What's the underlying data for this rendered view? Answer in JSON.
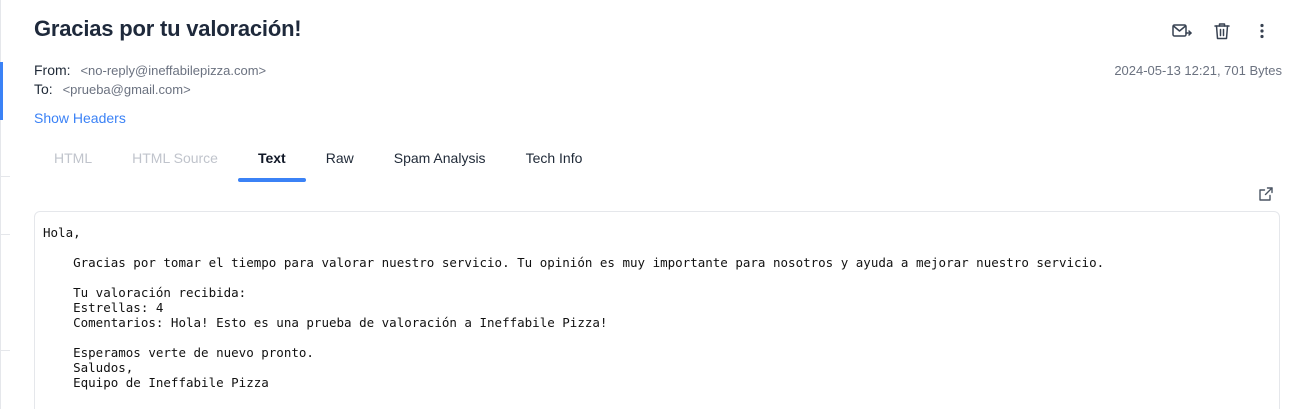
{
  "message": {
    "subject": "Gracias por tu valoración!",
    "from_label": "From:",
    "from_address": "<no-reply@ineffabilepizza.com>",
    "to_label": "To:",
    "to_address": "<prueba@gmail.com>",
    "date_size": "2024-05-13 12:21, 701 Bytes",
    "show_headers": "Show Headers"
  },
  "actions": {
    "forward_icon": "mail-forward-icon",
    "delete_icon": "trash-icon",
    "more_icon": "more-vertical-icon"
  },
  "tabs": [
    {
      "label": "HTML",
      "state": "disabled"
    },
    {
      "label": "HTML Source",
      "state": "disabled"
    },
    {
      "label": "Text",
      "state": "active"
    },
    {
      "label": "Raw",
      "state": "normal"
    },
    {
      "label": "Spam Analysis",
      "state": "normal"
    },
    {
      "label": "Tech Info",
      "state": "normal"
    }
  ],
  "body": {
    "text": "Hola,\n\n    Gracias por tomar el tiempo para valorar nuestro servicio. Tu opinión es muy importante para nosotros y ayuda a mejorar nuestro servicio.\n\n    Tu valoración recibida:\n    Estrellas: 4\n    Comentarios: Hola! Esto es una prueba de valoración a Ineffabile Pizza!\n\n    Esperamos verte de nuevo pronto.\n    Saludos,\n    Equipo de Ineffabile Pizza",
    "open_icon": "external-link-icon"
  },
  "colors": {
    "accent": "#3b82f6",
    "disabled_tab": "#c0c4cc",
    "muted_text": "#6b7280"
  }
}
